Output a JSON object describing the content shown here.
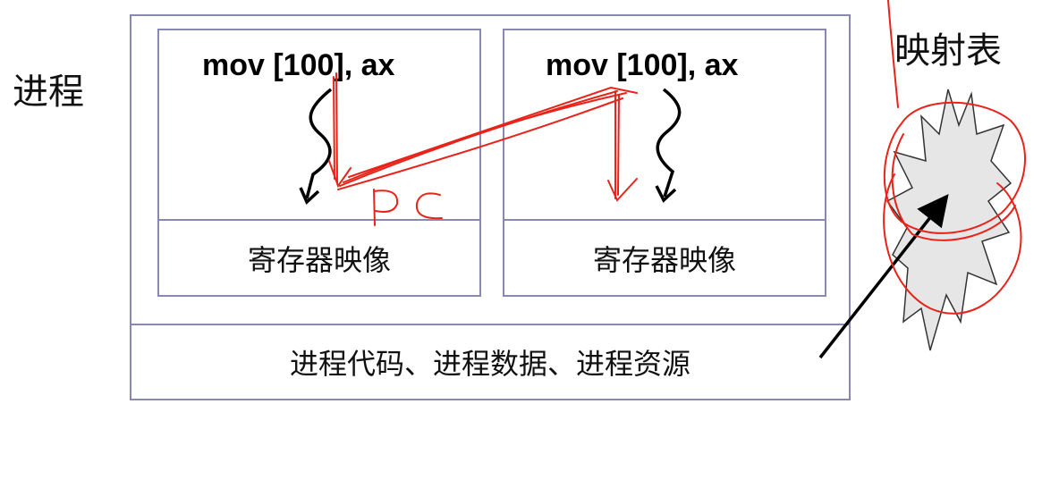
{
  "labels": {
    "process": "进程",
    "mapping_table": "映射表"
  },
  "threads": [
    {
      "instruction": "mov [100], ax",
      "register_image": "寄存器映像"
    },
    {
      "instruction": "mov [100], ax",
      "register_image": "寄存器映像"
    }
  ],
  "shared_resources": "进程代码、进程数据、进程资源",
  "annotation": {
    "handwritten_text": "PC",
    "color": "#e8231a"
  },
  "colors": {
    "box_border": "#8888b0",
    "starburst_fill": "#e6e6e6"
  }
}
